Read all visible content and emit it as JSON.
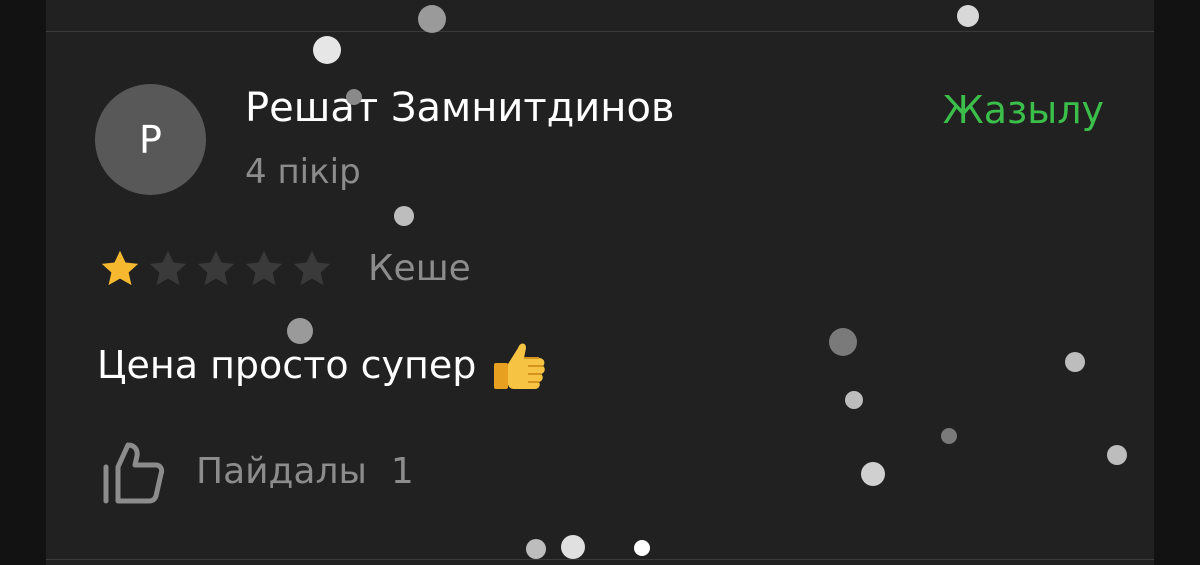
{
  "review": {
    "author": {
      "name": "Решат Замнитдинов",
      "initial": "Р",
      "review_count": "4 пікір"
    },
    "subscribe_label": "Жазылу",
    "rating": {
      "value": 1,
      "max": 5
    },
    "date": "Кеше",
    "text": "Цена просто супер",
    "emoji": "thumbs-up-emoji",
    "helpful": {
      "label": "Пайдалы",
      "count": "1"
    }
  },
  "colors": {
    "background": "#121212",
    "card": "#212121",
    "accent": "#3cbf4a",
    "star_filled": "#f5b82e",
    "star_empty": "#3a3a3a",
    "text_primary": "#ffffff",
    "text_secondary": "#8c8c8c",
    "avatar": "#585858"
  },
  "icons": {
    "helpful": "thumbs-up-outline-icon",
    "star": "star-icon"
  }
}
